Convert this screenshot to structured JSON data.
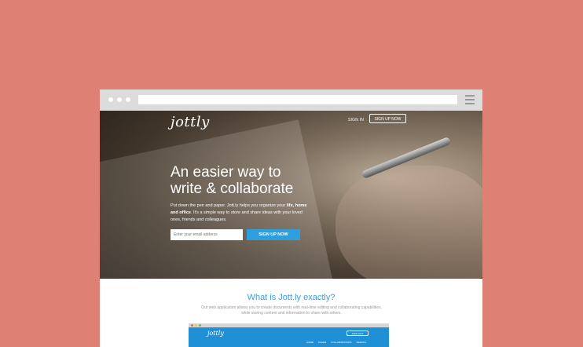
{
  "brand": {
    "logo_text": "jottly"
  },
  "nav": {
    "signin_label": "SIGN IN",
    "signup_label": "SIGN UP NOW"
  },
  "hero": {
    "headline_line1": "An easier way to",
    "headline_line2": "write & collaborate",
    "subtext_part1": "Put down the pen and paper. Jott.ly helps you organize your ",
    "subtext_bold1": "life,",
    "subtext_part2": " ",
    "subtext_bold2": "home and office",
    "subtext_part3": ". It's a simple way to store and share ideas with your loved ones, friends and colleagues.",
    "email_placeholder": "Enter your email address",
    "signup_button": "SIGN UP NOW"
  },
  "section": {
    "title": "What is Jott.ly exactly?",
    "description": "Our web application allows you to create documents with real-time editing and collaborating capabilities, while storing content and information to share with others."
  },
  "preview": {
    "logo_text": "jottly",
    "signout_label": "SIGN OUT",
    "nav_items": [
      "HOME",
      "PAGES",
      "COLLABORATORS",
      "SEARCH"
    ]
  },
  "colors": {
    "background": "#de8174",
    "accent": "#2d9fdf",
    "chrome": "#dcdcdc"
  }
}
